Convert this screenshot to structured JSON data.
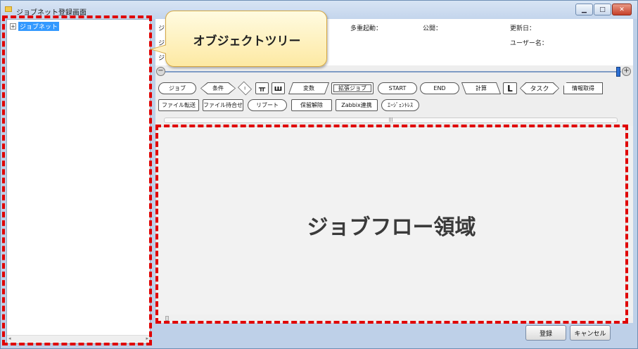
{
  "window": {
    "title": "ジョブネット登録画面",
    "minimize": "▁",
    "maximize": "□",
    "close": "✕"
  },
  "tree": {
    "expander": "+",
    "root_label": "ジョブネット",
    "scroll_left": "◂",
    "scroll_right": "▸"
  },
  "info": {
    "label_j1": "ジ",
    "label_j2": "ジ",
    "label_j3": "ジ",
    "multi_start": "多重起動：",
    "public": "公開：",
    "updated": "更新日：",
    "username": "ユーザー名："
  },
  "zoom": {
    "minus": "−",
    "plus": "+"
  },
  "palette": {
    "row1": [
      "ジョブ",
      "条件",
      "Ⅰ",
      "ㅠ",
      "ш",
      "変数",
      "拡張ジョブ",
      "START",
      "END",
      "計算",
      "L",
      "タスク",
      "情報取得"
    ],
    "row2": [
      "ファイル転送",
      "ファイル待合せ",
      "リブート",
      "保留解除",
      "Zabbix連携",
      "ｴｰｼﾞｪﾝﾄﾚｽ"
    ]
  },
  "flow": {
    "scroll_grip": "|||",
    "area_label": "ジョブフロー領域"
  },
  "buttons": {
    "register": "登録",
    "cancel": "キャンセル"
  },
  "callout": {
    "text": "オブジェクトツリー"
  },
  "colors": {
    "highlight_dash": "#e00000",
    "callout_fill": "#fde9a3",
    "selection": "#3399ff"
  }
}
